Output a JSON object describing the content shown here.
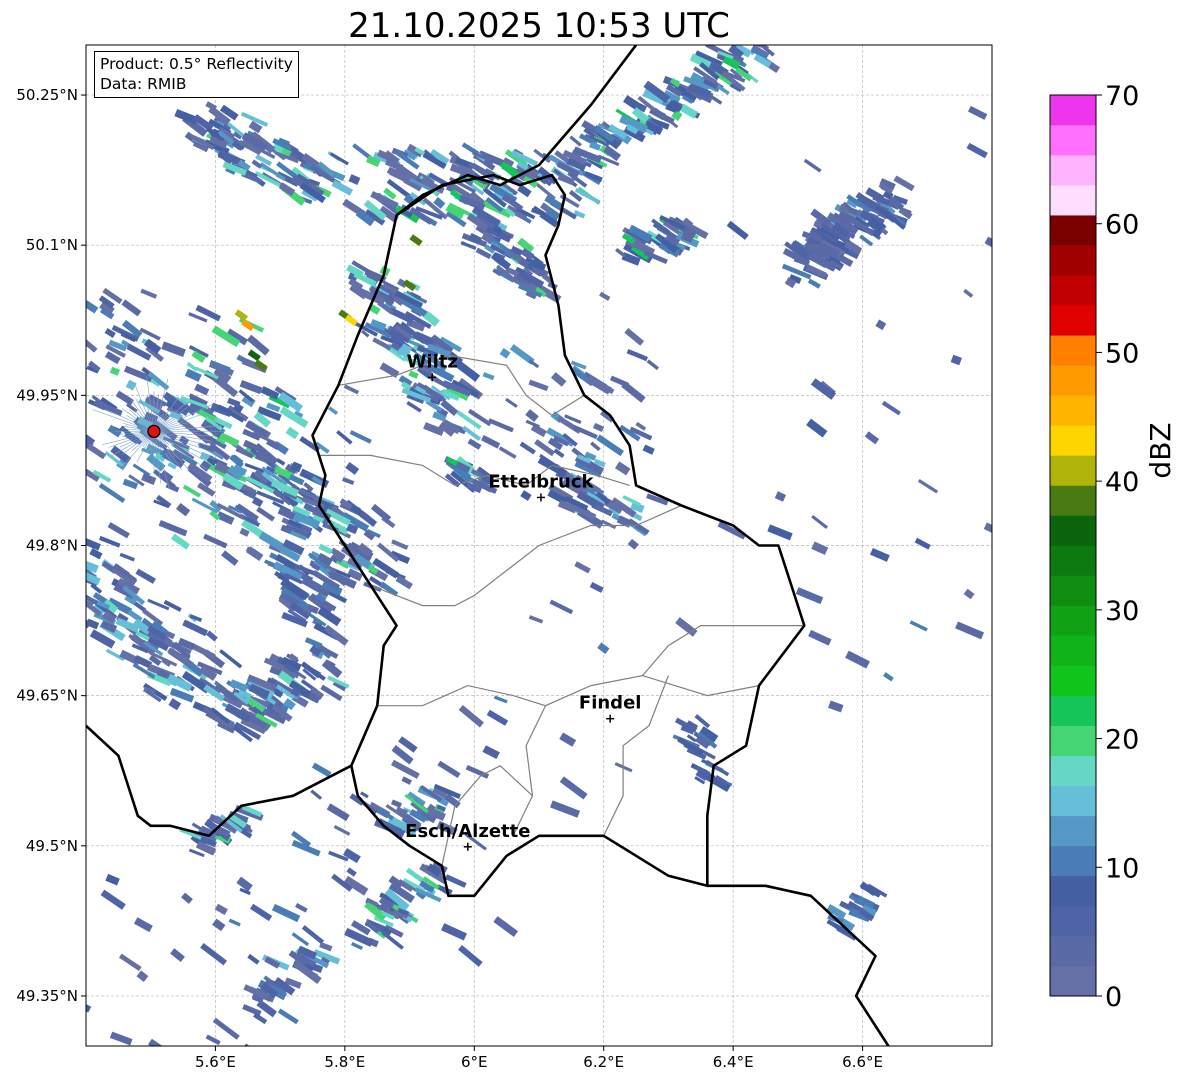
{
  "title": "21.10.2025 10:53 UTC",
  "info": {
    "product": "Product: 0.5° Reflectivity",
    "data": "Data: RMIB"
  },
  "map": {
    "lon_range": [
      5.4,
      6.8
    ],
    "lat_range": [
      49.3,
      50.3
    ],
    "lat_ticks": [
      {
        "value": 50.25,
        "label": "50.25°N"
      },
      {
        "value": 50.1,
        "label": "50.1°N"
      },
      {
        "value": 49.95,
        "label": "49.95°N"
      },
      {
        "value": 49.8,
        "label": "49.8°N"
      },
      {
        "value": 49.65,
        "label": "49.65°N"
      },
      {
        "value": 49.5,
        "label": "49.5°N"
      },
      {
        "value": 49.35,
        "label": "49.35°N"
      }
    ],
    "lon_ticks": [
      {
        "value": 5.6,
        "label": "5.6°E"
      },
      {
        "value": 5.8,
        "label": "5.8°E"
      },
      {
        "value": 6.0,
        "label": "6°E"
      },
      {
        "value": 6.2,
        "label": "6.2°E"
      },
      {
        "value": 6.4,
        "label": "6.4°E"
      },
      {
        "value": 6.6,
        "label": "6.6°E"
      }
    ],
    "grid": true,
    "cities": [
      {
        "name": "Wiltz",
        "lon": 5.935,
        "lat": 49.968
      },
      {
        "name": "Ettelbruck",
        "lon": 6.103,
        "lat": 49.848
      },
      {
        "name": "Findel",
        "lon": 6.21,
        "lat": 49.627
      },
      {
        "name": "Esch/Alzette",
        "lon": 5.99,
        "lat": 49.499
      }
    ],
    "radar_site": {
      "lon": 5.505,
      "lat": 49.914
    },
    "border_color": "#000000",
    "canton_color": "#808080",
    "border_path": [
      [
        6.12,
        50.17
      ],
      [
        6.14,
        50.15
      ],
      [
        6.13,
        50.12
      ],
      [
        6.11,
        50.09
      ],
      [
        6.13,
        50.04
      ],
      [
        6.14,
        49.99
      ],
      [
        6.17,
        49.95
      ],
      [
        6.21,
        49.93
      ],
      [
        6.24,
        49.9
      ],
      [
        6.25,
        49.86
      ],
      [
        6.32,
        49.84
      ],
      [
        6.4,
        49.82
      ],
      [
        6.44,
        49.8
      ],
      [
        6.47,
        49.8
      ],
      [
        6.49,
        49.76
      ],
      [
        6.51,
        49.72
      ],
      [
        6.44,
        49.66
      ],
      [
        6.42,
        49.6
      ],
      [
        6.37,
        49.58
      ],
      [
        6.36,
        49.53
      ],
      [
        6.36,
        49.46
      ],
      [
        6.3,
        49.47
      ],
      [
        6.2,
        49.51
      ],
      [
        6.1,
        49.51
      ],
      [
        6.05,
        49.49
      ],
      [
        6.0,
        49.45
      ],
      [
        5.96,
        49.45
      ],
      [
        5.95,
        49.48
      ],
      [
        5.9,
        49.5
      ],
      [
        5.86,
        49.52
      ],
      [
        5.82,
        49.55
      ],
      [
        5.81,
        49.58
      ],
      [
        5.85,
        49.64
      ],
      [
        5.86,
        49.7
      ],
      [
        5.88,
        49.72
      ],
      [
        5.84,
        49.76
      ],
      [
        5.8,
        49.8
      ],
      [
        5.76,
        49.84
      ],
      [
        5.77,
        49.87
      ],
      [
        5.75,
        49.91
      ],
      [
        5.79,
        49.96
      ],
      [
        5.82,
        50.01
      ],
      [
        5.86,
        50.07
      ],
      [
        5.88,
        50.13
      ],
      [
        5.95,
        50.16
      ],
      [
        6.03,
        50.17
      ],
      [
        6.07,
        50.16
      ],
      [
        6.12,
        50.17
      ]
    ],
    "country_lines": [
      [
        [
          5.4,
          49.62
        ],
        [
          5.45,
          49.59
        ],
        [
          5.48,
          49.53
        ],
        [
          5.5,
          49.52
        ],
        [
          5.53,
          49.52
        ],
        [
          5.59,
          49.51
        ],
        [
          5.64,
          49.54
        ],
        [
          5.72,
          49.55
        ],
        [
          5.78,
          49.57
        ],
        [
          5.81,
          49.58
        ]
      ],
      [
        [
          5.88,
          50.13
        ],
        [
          5.92,
          50.15
        ],
        [
          5.99,
          50.17
        ],
        [
          6.04,
          50.16
        ],
        [
          6.1,
          50.18
        ],
        [
          6.14,
          50.21
        ],
        [
          6.18,
          50.24
        ],
        [
          6.25,
          50.3
        ]
      ],
      [
        [
          6.36,
          49.46
        ],
        [
          6.45,
          49.46
        ],
        [
          6.52,
          49.45
        ],
        [
          6.57,
          49.42
        ],
        [
          6.62,
          49.39
        ],
        [
          6.59,
          49.35
        ],
        [
          6.62,
          49.32
        ],
        [
          6.65,
          49.29
        ]
      ]
    ],
    "canton_lines": [
      [
        [
          5.79,
          49.96
        ],
        [
          5.88,
          49.97
        ],
        [
          5.96,
          49.99
        ],
        [
          6.05,
          49.98
        ],
        [
          6.08,
          49.95
        ],
        [
          6.12,
          49.93
        ],
        [
          6.17,
          49.95
        ]
      ],
      [
        [
          5.76,
          49.89
        ],
        [
          5.84,
          49.89
        ],
        [
          5.92,
          49.88
        ],
        [
          5.97,
          49.86
        ],
        [
          6.02,
          49.87
        ],
        [
          6.08,
          49.86
        ],
        [
          6.12,
          49.88
        ],
        [
          6.19,
          49.87
        ],
        [
          6.24,
          49.86
        ]
      ],
      [
        [
          5.84,
          49.76
        ],
        [
          5.92,
          49.74
        ],
        [
          5.97,
          49.74
        ],
        [
          6.0,
          49.75
        ],
        [
          6.06,
          49.78
        ],
        [
          6.1,
          49.8
        ],
        [
          6.18,
          49.82
        ],
        [
          6.25,
          49.82
        ],
        [
          6.32,
          49.84
        ]
      ],
      [
        [
          5.85,
          49.64
        ],
        [
          5.92,
          49.64
        ],
        [
          5.99,
          49.66
        ],
        [
          6.06,
          49.65
        ],
        [
          6.11,
          49.64
        ],
        [
          6.18,
          49.66
        ],
        [
          6.26,
          49.67
        ],
        [
          6.36,
          49.65
        ],
        [
          6.44,
          49.66
        ]
      ],
      [
        [
          6.11,
          49.64
        ],
        [
          6.08,
          49.6
        ],
        [
          6.09,
          49.55
        ],
        [
          6.06,
          49.51
        ]
      ],
      [
        [
          5.95,
          49.48
        ],
        [
          5.97,
          49.54
        ],
        [
          6.01,
          49.57
        ],
        [
          6.04,
          49.58
        ],
        [
          6.09,
          49.55
        ]
      ],
      [
        [
          6.2,
          49.51
        ],
        [
          6.23,
          49.55
        ],
        [
          6.23,
          49.6
        ],
        [
          6.27,
          49.62
        ],
        [
          6.3,
          49.67
        ]
      ],
      [
        [
          6.26,
          49.67
        ],
        [
          6.3,
          49.7
        ],
        [
          6.35,
          49.72
        ],
        [
          6.42,
          49.72
        ],
        [
          6.51,
          49.72
        ]
      ]
    ]
  },
  "colorbar": {
    "label": "dBZ",
    "vmin": 0,
    "vmax": 70,
    "step": 2.5,
    "ticks": [
      {
        "value": 0,
        "label": "0"
      },
      {
        "value": 10,
        "label": "10"
      },
      {
        "value": 20,
        "label": "20"
      },
      {
        "value": 30,
        "label": "30"
      },
      {
        "value": 40,
        "label": "40"
      },
      {
        "value": 50,
        "label": "50"
      },
      {
        "value": 60,
        "label": "60"
      },
      {
        "value": 70,
        "label": "70"
      }
    ],
    "colors": [
      "#6470a6",
      "#5a6aa6",
      "#4f64a6",
      "#455fa3",
      "#4a7db5",
      "#5598c5",
      "#65bfd8",
      "#65d8c5",
      "#45d575",
      "#15c55a",
      "#10c41c",
      "#10b318",
      "#10a214",
      "#0e8d10",
      "#0c7a0e",
      "#0a650d",
      "#4a7a12",
      "#b0b30a",
      "#ffd500",
      "#ffb500",
      "#ff9a00",
      "#ff7f00",
      "#e00000",
      "#c00000",
      "#a00000",
      "#7a0000",
      "#ffddff",
      "#ffb3ff",
      "#ff70ff",
      "#ee35ee"
    ]
  },
  "echoes": [
    {
      "lon0": 5.42,
      "lat0": 49.98,
      "lon1": 5.73,
      "lat1": 49.85,
      "n": 260,
      "width": 0.18,
      "dbz": [
        2,
        23
      ],
      "streak": true
    },
    {
      "lon0": 5.56,
      "lat0": 50.22,
      "lon1": 5.78,
      "lat1": 50.16,
      "n": 90,
      "width": 0.05,
      "dbz": [
        2,
        22
      ],
      "streak": true
    },
    {
      "lon0": 5.86,
      "lat0": 50.16,
      "lon1": 6.15,
      "lat1": 50.16,
      "n": 140,
      "width": 0.07,
      "dbz": [
        2,
        24
      ],
      "streak": true
    },
    {
      "lon0": 6.15,
      "lat0": 50.18,
      "lon1": 6.45,
      "lat1": 50.3,
      "n": 120,
      "width": 0.04,
      "dbz": [
        2,
        24
      ],
      "streak": true
    },
    {
      "lon0": 6.5,
      "lat0": 50.08,
      "lon1": 6.66,
      "lat1": 50.15,
      "n": 110,
      "width": 0.04,
      "dbz": [
        2,
        14
      ],
      "streak": true
    },
    {
      "lon0": 6.24,
      "lat0": 50.1,
      "lon1": 6.34,
      "lat1": 50.12,
      "n": 40,
      "width": 0.03,
      "dbz": [
        2,
        25
      ],
      "streak": true
    },
    {
      "lon0": 5.4,
      "lat0": 49.78,
      "lon1": 5.58,
      "lat1": 49.66,
      "n": 110,
      "width": 0.08,
      "dbz": [
        2,
        20
      ],
      "streak": true
    },
    {
      "lon0": 5.7,
      "lat0": 49.86,
      "lon1": 5.85,
      "lat1": 49.78,
      "n": 90,
      "width": 0.07,
      "dbz": [
        2,
        22
      ],
      "streak": true
    },
    {
      "lon0": 5.62,
      "lat0": 49.63,
      "lon1": 5.78,
      "lat1": 49.68,
      "n": 80,
      "width": 0.05,
      "dbz": [
        2,
        22
      ],
      "streak": true
    },
    {
      "lon0": 5.7,
      "lat0": 49.78,
      "lon1": 5.78,
      "lat1": 49.71,
      "n": 40,
      "width": 0.05,
      "dbz": [
        2,
        16
      ],
      "streak": true
    },
    {
      "lon0": 5.84,
      "lat0": 50.06,
      "lon1": 5.97,
      "lat1": 49.93,
      "n": 110,
      "width": 0.06,
      "dbz": [
        2,
        22
      ],
      "streak": true
    },
    {
      "lon0": 6.0,
      "lat0": 50.12,
      "lon1": 6.12,
      "lat1": 50.05,
      "n": 50,
      "width": 0.04,
      "dbz": [
        2,
        22
      ],
      "streak": true
    },
    {
      "lon0": 5.96,
      "lat0": 49.88,
      "lon1": 6.02,
      "lat1": 49.86,
      "n": 20,
      "width": 0.02,
      "dbz": [
        2,
        26
      ],
      "streak": true
    },
    {
      "lon0": 6.14,
      "lat0": 49.86,
      "lon1": 6.25,
      "lat1": 49.82,
      "n": 40,
      "width": 0.03,
      "dbz": [
        2,
        20
      ],
      "streak": true
    },
    {
      "lon0": 6.34,
      "lat0": 49.62,
      "lon1": 6.37,
      "lat1": 49.57,
      "n": 25,
      "width": 0.03,
      "dbz": [
        5,
        16
      ],
      "streak": true
    },
    {
      "lon0": 6.56,
      "lat0": 49.42,
      "lon1": 6.62,
      "lat1": 49.45,
      "n": 20,
      "width": 0.02,
      "dbz": [
        5,
        15
      ],
      "streak": true
    },
    {
      "lon0": 5.86,
      "lat0": 49.52,
      "lon1": 5.96,
      "lat1": 49.55,
      "n": 30,
      "width": 0.03,
      "dbz": [
        2,
        22
      ],
      "streak": true
    },
    {
      "lon0": 5.84,
      "lat0": 49.42,
      "lon1": 5.94,
      "lat1": 49.47,
      "n": 45,
      "width": 0.03,
      "dbz": [
        2,
        22
      ],
      "streak": true
    },
    {
      "lon0": 5.56,
      "lat0": 49.5,
      "lon1": 5.66,
      "lat1": 49.53,
      "n": 30,
      "width": 0.02,
      "dbz": [
        2,
        22
      ],
      "streak": true
    },
    {
      "lon0": 5.66,
      "lat0": 49.34,
      "lon1": 5.76,
      "lat1": 49.4,
      "n": 30,
      "width": 0.03,
      "dbz": [
        2,
        22
      ],
      "streak": true
    },
    {
      "lon0": 5.4,
      "lat0": 49.3,
      "lon1": 6.0,
      "lat1": 49.56,
      "n": 80,
      "width": 0.25,
      "dbz": [
        2,
        12
      ],
      "streak": true
    },
    {
      "lon0": 6.25,
      "lat0": 49.7,
      "lon1": 6.8,
      "lat1": 50.05,
      "n": 60,
      "width": 0.45,
      "dbz": [
        2,
        12
      ],
      "streak": true
    },
    {
      "lon0": 6.05,
      "lat0": 49.95,
      "lon1": 6.25,
      "lat1": 49.9,
      "n": 50,
      "width": 0.1,
      "dbz": [
        2,
        16
      ],
      "streak": true
    }
  ],
  "hot_spots": [
    {
      "lon": 5.8,
      "lat": 50.03,
      "dbz": 42
    },
    {
      "lon": 5.81,
      "lat": 50.025,
      "dbz": 45
    },
    {
      "lon": 5.9,
      "lat": 50.06,
      "dbz": 40
    },
    {
      "lon": 5.66,
      "lat": 49.99,
      "dbz": 38
    },
    {
      "lon": 5.67,
      "lat": 49.98,
      "dbz": 42
    },
    {
      "lon": 5.65,
      "lat": 50.02,
      "dbz": 50
    },
    {
      "lon": 5.64,
      "lat": 50.03,
      "dbz": 44
    },
    {
      "lon": 5.91,
      "lat": 50.105,
      "dbz": 40
    }
  ]
}
